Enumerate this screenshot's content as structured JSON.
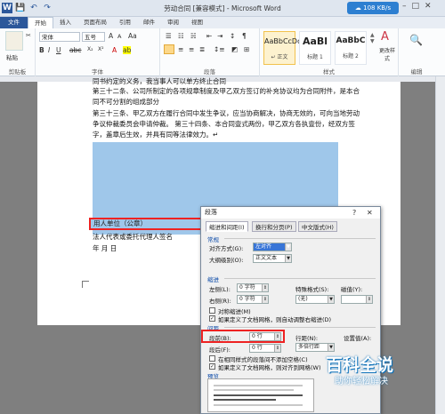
{
  "window": {
    "title": "劳动合同 [兼容模式] - Microsoft Word",
    "cloud": "108 KB/s"
  },
  "qat": {
    "save": "💾",
    "undo": "↶",
    "redo": "↷"
  },
  "tabs": [
    "文件",
    "开始",
    "插入",
    "页面布局",
    "引用",
    "邮件",
    "审阅",
    "视图"
  ],
  "ribbon": {
    "clipboard": {
      "paste": "粘贴",
      "label": "剪贴板"
    },
    "font": {
      "name": "宋体",
      "size": "五号",
      "label": "字体"
    },
    "paragraph": {
      "label": "段落"
    },
    "styles": {
      "label": "样式",
      "items": [
        {
          "preview": "AaBbCcDd",
          "name": "↵ 正文"
        },
        {
          "preview": "AaBl",
          "name": "标题 1"
        },
        {
          "preview": "AaBbC",
          "name": "标题 2"
        }
      ],
      "change": "更改样式"
    },
    "edit": {
      "label": "编辑"
    }
  },
  "doc": {
    "lines": [
      "同书约定的义务，我当事人可以单方终止合同",
      "第三十二条、公司所制定的各项规章制度及甲乙双方签订的补充协议均为合同附件，是本合",
      "同不可分割的组成部分",
      "第三十三条、甲乙双方在履行合同中发生争议，应当协商解决，协商无效的，可向当地劳动",
      "争议仲裁委员会申请仲裁。  第三十四条、本合同壹式两份，甲乙双方各执壹份，经双方签",
      "字，盖章后生效，并具有同等法律效力。↵"
    ],
    "employer": "用人单位（公章）",
    "signer": "法人代表或委托代理人签名",
    "date": "年      月      日"
  },
  "dialog": {
    "title": "段落",
    "tabs": [
      "缩进和间距(I)",
      "换行和分页(P)",
      "中文版式(H)"
    ],
    "general": {
      "label": "常规",
      "align_label": "对齐方式(G):",
      "align_value": "左对齐",
      "outline_label": "大纲级别(O):",
      "outline_value": "正文文本"
    },
    "indent": {
      "label": "缩进",
      "left_label": "左侧(L):",
      "left_value": "0 字符",
      "right_label": "右侧(R):",
      "right_value": "0 字符",
      "special_label": "特殊格式(S):",
      "special_value": "(无)",
      "by_label": "磁值(Y):",
      "mirror": "对称缩进(M)",
      "grid": "如果定义了文档网格，则自动调整右缩进(D)"
    },
    "spacing": {
      "label": "间距",
      "before_label": "段前(B):",
      "before_value": "0 行",
      "after_label": "段后(F):",
      "after_value": "0 行",
      "line_label": "行距(N):",
      "line_value": "多倍行距",
      "at_label": "设置值(A):",
      "same_style": "在相同样式的段落间不添加空格(C)",
      "snap": "如果定义了文档网格，则对齐到网格(W)"
    },
    "preview": {
      "label": "预览"
    }
  },
  "watermark": {
    "title": "百科全说",
    "sub": "助你轻松解决"
  }
}
